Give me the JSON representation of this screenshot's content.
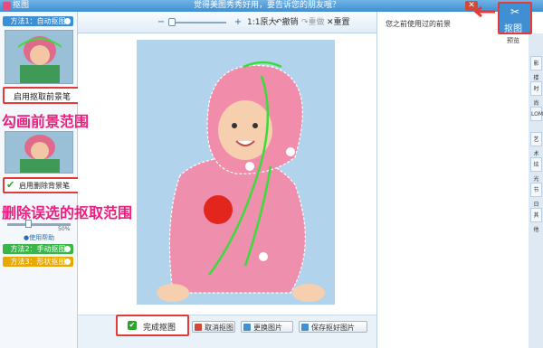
{
  "window": {
    "app_title": "抠图",
    "title": "觉得美图秀秀好用，要告诉您的朋友哦？",
    "close_glyph": "✕"
  },
  "toolbar": {
    "zoom_out_icon": "−",
    "zoom_in_icon": "+",
    "actual_size": "1:1原大",
    "undo": "撤销",
    "redo": "重做",
    "reset": "重置"
  },
  "left_panel": {
    "method1": "方法1：自动抠图",
    "enable_fg_brush": "启用抠取前景笔",
    "enable_bg_brush": "启用删除背景笔",
    "brush_size_label": "50%",
    "help": "使用帮助",
    "method2": "方法2：手动抠图",
    "method3": "方法3：形状抠图"
  },
  "annotations": {
    "outline_fg": "勾画前景范围",
    "remove_wrong": "删除误选的抠取范围",
    "cutout_badge": "抠图"
  },
  "bottom_bar": {
    "finish": "完成抠图",
    "cancel": "取消抠图",
    "replace": "更换图片",
    "save": "保存抠好图片"
  },
  "right_panel": {
    "history_label": "您之前使用过的前景",
    "preview": "预览",
    "tabs": [
      "影楼",
      "时尚",
      "LOMO",
      "艺术",
      "炫光",
      "节日",
      "其他"
    ]
  },
  "colors": {
    "accent": "#3f8fd2",
    "annotation": "#ef1c7d",
    "red_box": "#e53a3a",
    "method1": "#3a8fd6",
    "method2": "#3ab54a",
    "method3": "#e8a800"
  }
}
